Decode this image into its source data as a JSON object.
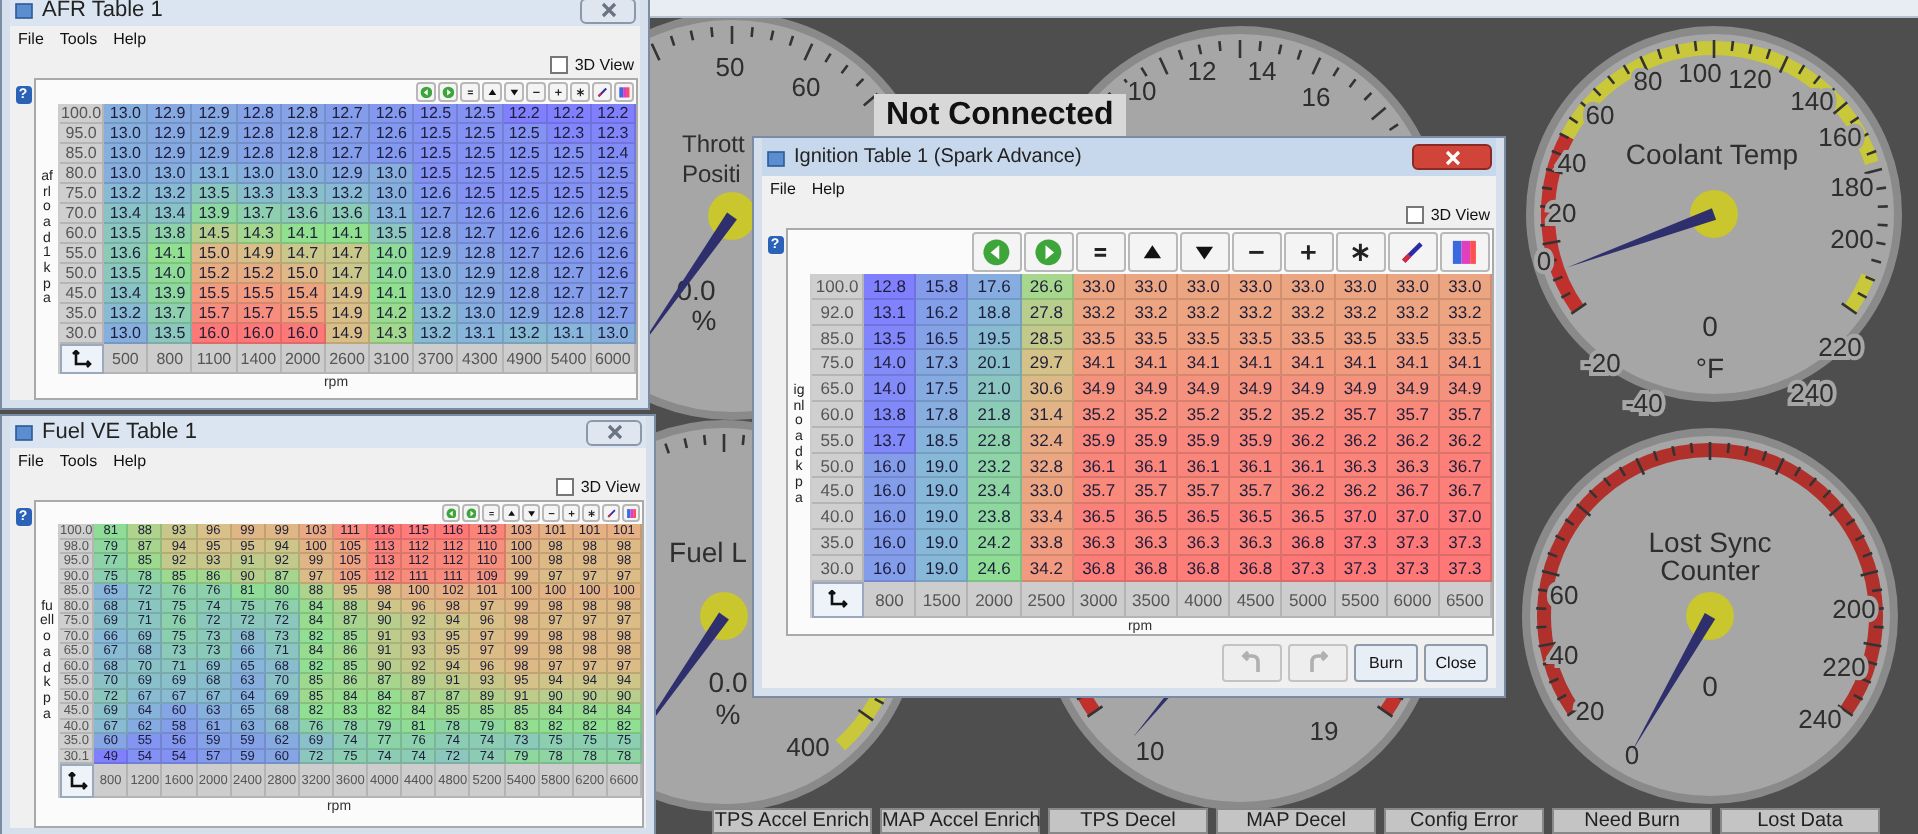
{
  "desktop": {
    "status": "Not Connected",
    "gauges": [
      {
        "title_lines": [
          "Thrott",
          "Positi"
        ],
        "scale": [
          "50",
          "60"
        ],
        "reading": "0.0",
        "unit": "%"
      },
      {
        "title_lines": [
          "Fuel L"
        ],
        "scale": [
          "400"
        ],
        "reading": "0.0",
        "unit": "%"
      },
      {
        "scale": [
          "10",
          "12",
          "14",
          "16"
        ]
      },
      {
        "scale": [
          "10",
          "19"
        ]
      },
      {
        "title_lines": [
          "Coolant Temp"
        ],
        "scale": [
          "60",
          "80",
          "100",
          "120",
          "140",
          "160",
          "180",
          "200",
          "40",
          "20",
          "0",
          "-20",
          "-40",
          "220",
          "240"
        ],
        "reading": "0",
        "unit": "°F"
      },
      {
        "title_lines": [
          "Lost Sync",
          "Counter"
        ],
        "scale": [
          "60",
          "40",
          "20",
          "0",
          "200",
          "220",
          "240"
        ],
        "reading": "0"
      }
    ],
    "indicators": [
      "TPS Accel Enrich",
      "MAP Accel Enrich",
      "TPS Decel",
      "MAP Decel",
      "Config Error",
      "Need Burn",
      "Lost Data"
    ]
  },
  "windows": [
    {
      "title": "AFR Table 1",
      "active": false,
      "menu": [
        "File",
        "Tools",
        "Help"
      ],
      "view_toggle": {
        "label": "3D View",
        "checked": false
      },
      "help_icon": "?",
      "y_axis_label": "afrload1 kpa",
      "x_axis_label": "rpm",
      "rows": [
        {
          "load": "100.0",
          "cells": [
            "13.0",
            "12.9",
            "12.9",
            "12.8",
            "12.8",
            "12.7",
            "12.6",
            "12.5",
            "12.5",
            "12.2",
            "12.2",
            "12.2"
          ]
        },
        {
          "load": "95.0",
          "cells": [
            "13.0",
            "12.9",
            "12.9",
            "12.8",
            "12.8",
            "12.7",
            "12.6",
            "12.5",
            "12.5",
            "12.5",
            "12.3",
            "12.3"
          ]
        },
        {
          "load": "85.0",
          "cells": [
            "13.0",
            "12.9",
            "12.9",
            "12.8",
            "12.8",
            "12.7",
            "12.6",
            "12.5",
            "12.5",
            "12.5",
            "12.5",
            "12.4"
          ]
        },
        {
          "load": "80.0",
          "cells": [
            "13.0",
            "13.0",
            "13.1",
            "13.0",
            "13.0",
            "12.9",
            "13.0",
            "12.5",
            "12.5",
            "12.5",
            "12.5",
            "12.5"
          ]
        },
        {
          "load": "75.0",
          "cells": [
            "13.2",
            "13.2",
            "13.5",
            "13.3",
            "13.3",
            "13.2",
            "13.0",
            "12.6",
            "12.5",
            "12.5",
            "12.5",
            "12.5"
          ]
        },
        {
          "load": "70.0",
          "cells": [
            "13.4",
            "13.4",
            "13.9",
            "13.7",
            "13.6",
            "13.6",
            "13.1",
            "12.7",
            "12.6",
            "12.6",
            "12.6",
            "12.6"
          ]
        },
        {
          "load": "60.0",
          "cells": [
            "13.5",
            "13.8",
            "14.5",
            "14.3",
            "14.1",
            "14.1",
            "13.5",
            "12.8",
            "12.7",
            "12.6",
            "12.6",
            "12.6"
          ]
        },
        {
          "load": "55.0",
          "cells": [
            "13.6",
            "14.1",
            "15.0",
            "14.9",
            "14.7",
            "14.7",
            "14.0",
            "12.9",
            "12.8",
            "12.7",
            "12.6",
            "12.6"
          ]
        },
        {
          "load": "50.0",
          "cells": [
            "13.5",
            "14.0",
            "15.2",
            "15.2",
            "15.0",
            "14.7",
            "14.0",
            "13.0",
            "12.9",
            "12.8",
            "12.7",
            "12.6"
          ]
        },
        {
          "load": "45.0",
          "cells": [
            "13.4",
            "13.9",
            "15.5",
            "15.5",
            "15.4",
            "14.9",
            "14.1",
            "13.0",
            "12.9",
            "12.8",
            "12.7",
            "12.7"
          ]
        },
        {
          "load": "35.0",
          "cells": [
            "13.2",
            "13.7",
            "15.7",
            "15.7",
            "15.5",
            "14.9",
            "14.2",
            "13.2",
            "13.0",
            "12.9",
            "12.8",
            "12.7"
          ]
        },
        {
          "load": "30.0",
          "cells": [
            "13.0",
            "13.5",
            "16.0",
            "16.0",
            "16.0",
            "14.9",
            "14.3",
            "13.2",
            "13.1",
            "13.2",
            "13.1",
            "13.0"
          ]
        }
      ],
      "x_values": [
        "500",
        "800",
        "1100",
        "1400",
        "2000",
        "2600",
        "3100",
        "3700",
        "4300",
        "4900",
        "5400",
        "6000"
      ]
    },
    {
      "title": "Fuel VE Table 1",
      "active": false,
      "menu": [
        "File",
        "Tools",
        "Help"
      ],
      "view_toggle": {
        "label": "3D View",
        "checked": false
      },
      "help_icon": "?",
      "y_axis_label": "fuelload kpa",
      "x_axis_label": "rpm",
      "rows": [
        {
          "load": "100.0",
          "cells": [
            "81",
            "88",
            "93",
            "96",
            "99",
            "99",
            "103",
            "111",
            "116",
            "115",
            "116",
            "113",
            "103",
            "101",
            "101",
            "101"
          ]
        },
        {
          "load": "98.0",
          "cells": [
            "79",
            "87",
            "94",
            "95",
            "95",
            "94",
            "100",
            "105",
            "113",
            "112",
            "112",
            "110",
            "100",
            "98",
            "98",
            "98"
          ]
        },
        {
          "load": "95.0",
          "cells": [
            "77",
            "85",
            "92",
            "93",
            "91",
            "92",
            "99",
            "105",
            "113",
            "112",
            "112",
            "110",
            "100",
            "98",
            "98",
            "98"
          ]
        },
        {
          "load": "90.0",
          "cells": [
            "75",
            "78",
            "85",
            "86",
            "90",
            "87",
            "97",
            "105",
            "112",
            "111",
            "111",
            "109",
            "99",
            "97",
            "97",
            "97"
          ]
        },
        {
          "load": "85.0",
          "cells": [
            "65",
            "72",
            "76",
            "76",
            "81",
            "80",
            "88",
            "95",
            "98",
            "100",
            "102",
            "101",
            "100",
            "100",
            "100",
            "100"
          ]
        },
        {
          "load": "80.0",
          "cells": [
            "68",
            "71",
            "75",
            "74",
            "75",
            "76",
            "84",
            "88",
            "94",
            "96",
            "98",
            "97",
            "99",
            "98",
            "98",
            "98"
          ]
        },
        {
          "load": "75.0",
          "cells": [
            "69",
            "71",
            "76",
            "72",
            "72",
            "72",
            "84",
            "87",
            "90",
            "92",
            "94",
            "96",
            "98",
            "97",
            "97",
            "97"
          ]
        },
        {
          "load": "70.0",
          "cells": [
            "66",
            "69",
            "75",
            "73",
            "68",
            "73",
            "82",
            "85",
            "91",
            "93",
            "95",
            "97",
            "99",
            "98",
            "98",
            "98"
          ]
        },
        {
          "load": "65.0",
          "cells": [
            "67",
            "68",
            "73",
            "73",
            "66",
            "71",
            "84",
            "86",
            "91",
            "93",
            "95",
            "97",
            "99",
            "98",
            "98",
            "98"
          ]
        },
        {
          "load": "60.0",
          "cells": [
            "68",
            "70",
            "71",
            "69",
            "65",
            "68",
            "82",
            "85",
            "90",
            "92",
            "94",
            "96",
            "98",
            "97",
            "97",
            "97"
          ]
        },
        {
          "load": "55.0",
          "cells": [
            "70",
            "69",
            "69",
            "68",
            "63",
            "70",
            "85",
            "86",
            "87",
            "89",
            "91",
            "93",
            "95",
            "94",
            "94",
            "94"
          ]
        },
        {
          "load": "50.0",
          "cells": [
            "72",
            "67",
            "67",
            "67",
            "64",
            "69",
            "85",
            "84",
            "84",
            "87",
            "87",
            "89",
            "91",
            "90",
            "90",
            "90"
          ]
        },
        {
          "load": "45.0",
          "cells": [
            "69",
            "64",
            "60",
            "63",
            "65",
            "68",
            "82",
            "83",
            "82",
            "84",
            "85",
            "85",
            "85",
            "84",
            "84",
            "84"
          ]
        },
        {
          "load": "40.0",
          "cells": [
            "67",
            "62",
            "58",
            "61",
            "63",
            "68",
            "76",
            "78",
            "79",
            "81",
            "78",
            "79",
            "83",
            "82",
            "82",
            "82"
          ]
        },
        {
          "load": "35.0",
          "cells": [
            "60",
            "55",
            "56",
            "59",
            "59",
            "62",
            "69",
            "74",
            "77",
            "76",
            "74",
            "74",
            "73",
            "75",
            "75",
            "75"
          ]
        },
        {
          "load": "30.1",
          "cells": [
            "49",
            "54",
            "54",
            "57",
            "59",
            "60",
            "72",
            "75",
            "74",
            "74",
            "72",
            "74",
            "79",
            "78",
            "78",
            "78"
          ]
        }
      ],
      "x_values": [
        "800",
        "1200",
        "1600",
        "2000",
        "2400",
        "2800",
        "3200",
        "3600",
        "4000",
        "4400",
        "4800",
        "5200",
        "5400",
        "5800",
        "6200",
        "6600"
      ]
    },
    {
      "title": "Ignition Table 1 (Spark Advance)",
      "active": true,
      "menu": [
        "File",
        "Help"
      ],
      "view_toggle": {
        "label": "3D View",
        "checked": false
      },
      "help_icon": "?",
      "y_axis_label": "ignload kpa",
      "x_axis_label": "rpm",
      "rows": [
        {
          "load": "100.0",
          "cells": [
            "12.8",
            "15.8",
            "17.6",
            "26.6",
            "33.0",
            "33.0",
            "33.0",
            "33.0",
            "33.0",
            "33.0",
            "33.0",
            "33.0"
          ]
        },
        {
          "load": "92.0",
          "cells": [
            "13.1",
            "16.2",
            "18.8",
            "27.8",
            "33.2",
            "33.2",
            "33.2",
            "33.2",
            "33.2",
            "33.2",
            "33.2",
            "33.2"
          ]
        },
        {
          "load": "85.0",
          "cells": [
            "13.5",
            "16.5",
            "19.5",
            "28.5",
            "33.5",
            "33.5",
            "33.5",
            "33.5",
            "33.5",
            "33.5",
            "33.5",
            "33.5"
          ]
        },
        {
          "load": "75.0",
          "cells": [
            "14.0",
            "17.3",
            "20.1",
            "29.7",
            "34.1",
            "34.1",
            "34.1",
            "34.1",
            "34.1",
            "34.1",
            "34.1",
            "34.1"
          ]
        },
        {
          "load": "65.0",
          "cells": [
            "14.0",
            "17.5",
            "21.0",
            "30.6",
            "34.9",
            "34.9",
            "34.9",
            "34.9",
            "34.9",
            "34.9",
            "34.9",
            "34.9"
          ]
        },
        {
          "load": "60.0",
          "cells": [
            "13.8",
            "17.8",
            "21.8",
            "31.4",
            "35.2",
            "35.2",
            "35.2",
            "35.2",
            "35.2",
            "35.7",
            "35.7",
            "35.7"
          ]
        },
        {
          "load": "55.0",
          "cells": [
            "13.7",
            "18.5",
            "22.8",
            "32.4",
            "35.9",
            "35.9",
            "35.9",
            "35.9",
            "36.2",
            "36.2",
            "36.2",
            "36.2"
          ]
        },
        {
          "load": "50.0",
          "cells": [
            "16.0",
            "19.0",
            "23.2",
            "32.8",
            "36.1",
            "36.1",
            "36.1",
            "36.1",
            "36.1",
            "36.3",
            "36.3",
            "36.7"
          ]
        },
        {
          "load": "45.0",
          "cells": [
            "16.0",
            "19.0",
            "23.4",
            "33.0",
            "35.7",
            "35.7",
            "35.7",
            "35.7",
            "36.2",
            "36.2",
            "36.7",
            "36.7"
          ]
        },
        {
          "load": "40.0",
          "cells": [
            "16.0",
            "19.0",
            "23.8",
            "33.4",
            "36.5",
            "36.5",
            "36.5",
            "36.5",
            "36.5",
            "37.0",
            "37.0",
            "37.0"
          ]
        },
        {
          "load": "35.0",
          "cells": [
            "16.0",
            "19.0",
            "24.2",
            "33.8",
            "36.3",
            "36.3",
            "36.3",
            "36.3",
            "36.8",
            "37.3",
            "37.3",
            "37.3"
          ]
        },
        {
          "load": "30.0",
          "cells": [
            "16.0",
            "19.0",
            "24.6",
            "34.2",
            "36.8",
            "36.8",
            "36.8",
            "36.8",
            "37.3",
            "37.3",
            "37.3",
            "37.3"
          ]
        }
      ],
      "x_values": [
        "800",
        "1500",
        "2000",
        "2500",
        "3000",
        "3500",
        "4000",
        "4500",
        "5000",
        "5500",
        "6000",
        "6500"
      ],
      "buttons": [
        {
          "kind": "undo",
          "disabled": true
        },
        {
          "kind": "redo",
          "disabled": true
        },
        {
          "kind": "text",
          "label": "Burn",
          "disabled": false
        },
        {
          "kind": "text",
          "label": "Close",
          "disabled": false
        }
      ]
    }
  ]
}
